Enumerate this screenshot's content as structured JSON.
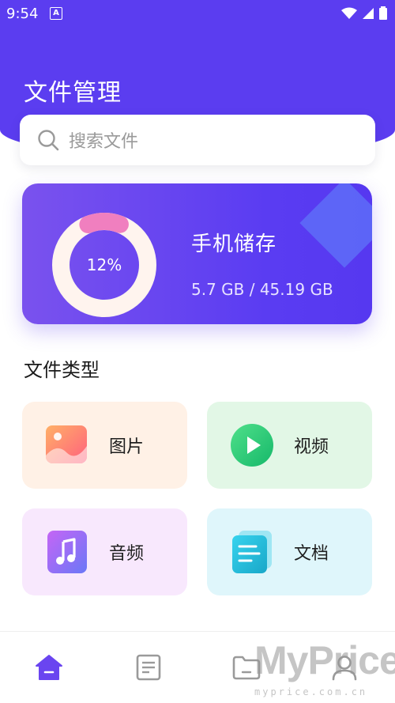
{
  "status_bar": {
    "time": "9:54",
    "notification_glyph": "A"
  },
  "header": {
    "title": "文件管理"
  },
  "search": {
    "placeholder": "搜索文件"
  },
  "storage": {
    "percent_label": "12%",
    "used_fraction": 0.12,
    "title": "手机储存",
    "usage": "5.7 GB / 45.19 GB"
  },
  "file_types": {
    "section_title": "文件类型",
    "items": [
      {
        "label": "图片",
        "icon": "image-icon"
      },
      {
        "label": "视频",
        "icon": "play-icon"
      },
      {
        "label": "音频",
        "icon": "music-icon"
      },
      {
        "label": "文档",
        "icon": "document-icon"
      }
    ]
  },
  "bottom_nav": {
    "active_index": 0,
    "items": [
      {
        "icon": "home-icon"
      },
      {
        "icon": "file-list-icon"
      },
      {
        "icon": "folder-icon"
      },
      {
        "icon": "profile-icon"
      }
    ]
  },
  "watermark": {
    "text": "MyPrice",
    "sub": "myprice.com.cn"
  },
  "colors": {
    "primary": "#5b3df0",
    "ring_track": "#fff4ee",
    "ring_progress": "#f07fbf",
    "nav_active": "#6a45f0",
    "nav_inactive": "#9a9a9a"
  }
}
